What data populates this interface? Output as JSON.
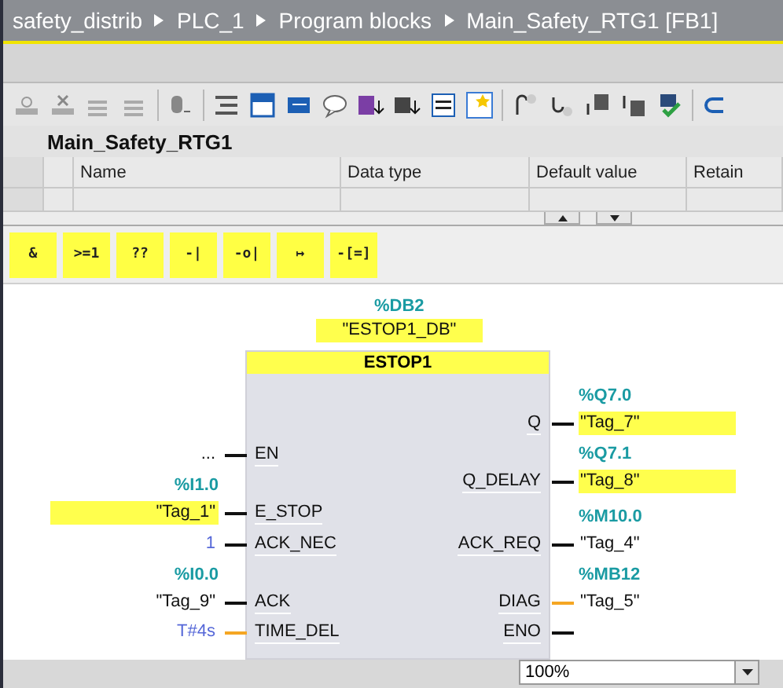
{
  "breadcrumb": [
    "safety_distrib",
    "PLC_1",
    "Program blocks",
    "Main_Safety_RTG1 [FB1]"
  ],
  "block_title": "Main_Safety_RTG1",
  "interface_table": {
    "columns": [
      "Name",
      "Data type",
      "Default value",
      "Retain"
    ]
  },
  "instructions": [
    "&",
    ">=1",
    "??",
    "-|",
    "-o|",
    "↦",
    "-[=]"
  ],
  "network": {
    "instance_address": "%DB2",
    "instance_name": "\"ESTOP1_DB\"",
    "block_name": "ESTOP1",
    "inputs": [
      {
        "pin": "EN",
        "operand": "...",
        "kind": "bool",
        "constant": false,
        "highlighted": false
      },
      {
        "pin": "E_STOP",
        "address": "%I1.0",
        "operand": "\"Tag_1\"",
        "kind": "bool",
        "constant": false,
        "highlighted": true
      },
      {
        "pin": "ACK_NEC",
        "operand": "1",
        "kind": "bool",
        "constant": true,
        "highlighted": false
      },
      {
        "pin": "ACK",
        "address": "%I0.0",
        "operand": "\"Tag_9\"",
        "kind": "bool",
        "constant": false,
        "highlighted": false
      },
      {
        "pin": "TIME_DEL",
        "operand": "T#4s",
        "kind": "data",
        "constant": true,
        "highlighted": false
      }
    ],
    "outputs": [
      {
        "pin": "Q",
        "address": "%Q7.0",
        "operand": "\"Tag_7\"",
        "kind": "bool",
        "highlighted": true
      },
      {
        "pin": "Q_DELAY",
        "address": "%Q7.1",
        "operand": "\"Tag_8\"",
        "kind": "bool",
        "highlighted": true
      },
      {
        "pin": "ACK_REQ",
        "address": "%M10.0",
        "operand": "\"Tag_4\"",
        "kind": "bool",
        "highlighted": false
      },
      {
        "pin": "DIAG",
        "address": "%MB12",
        "operand": "\"Tag_5\"",
        "kind": "data",
        "highlighted": false
      },
      {
        "pin": "ENO",
        "kind": "bool"
      }
    ]
  },
  "zoom": {
    "value": "100%"
  }
}
